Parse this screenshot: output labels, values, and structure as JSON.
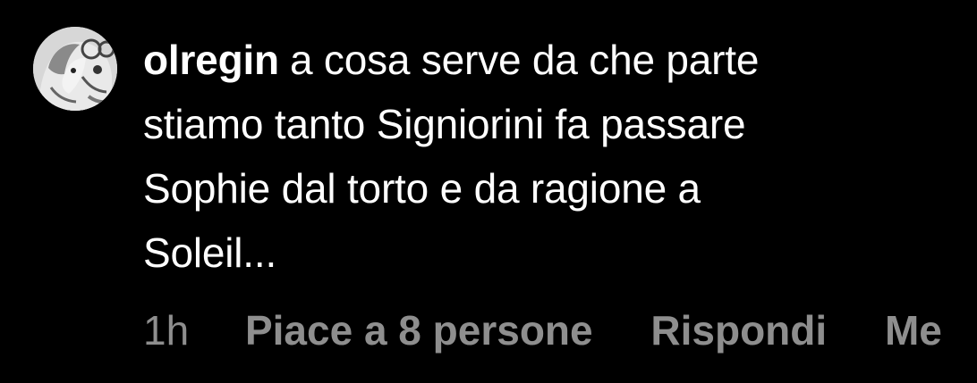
{
  "comment": {
    "avatar_icon": "user-avatar-icon",
    "username": "olregin",
    "text": "a cosa serve da che parte stiamo tanto Signiorini fa passare Sophie dal torto e da ragione a Soleil...",
    "lines": [
      "a cosa serve da che parte",
      "stiamo tanto Signiorini fa passare",
      "Sophie dal torto e da ragione a",
      "Soleil..."
    ],
    "timestamp": "1h",
    "likes_label": "Piace a 8 persone",
    "reply_label": "Rispondi",
    "more_label": "Me"
  },
  "colors": {
    "background": "#000000",
    "text": "#ffffff",
    "secondary_text": "#8e8e8e",
    "avatar_background": "#d9d9d9"
  }
}
